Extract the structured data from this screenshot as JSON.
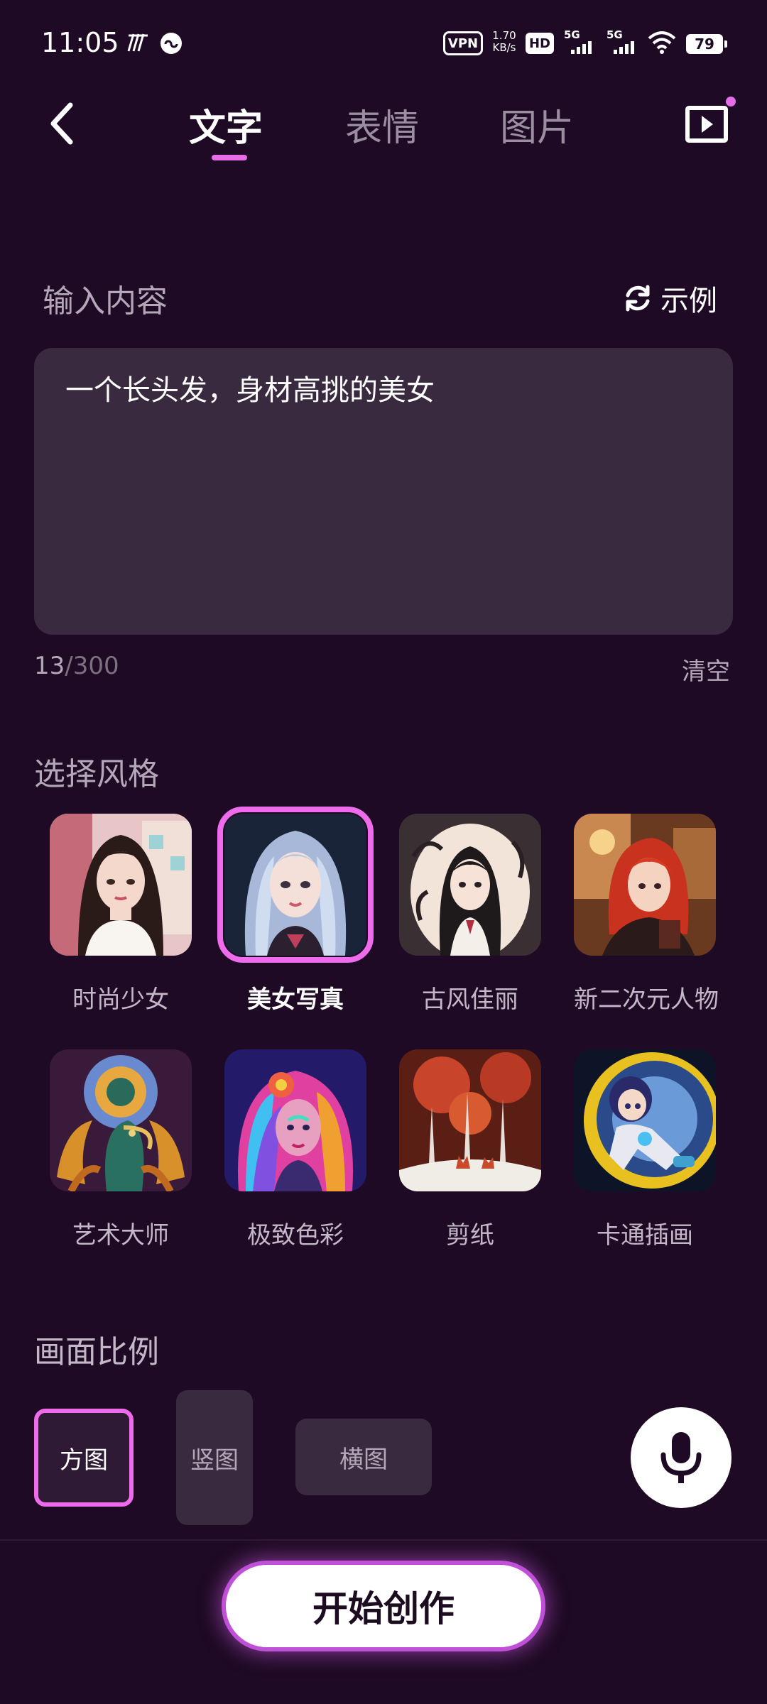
{
  "status_bar": {
    "time": "11:05",
    "vpn": "VPN",
    "speed_value": "1.70",
    "speed_unit": "KB/s",
    "hd": "HD",
    "net1": "5G",
    "net2": "5G",
    "battery": "79"
  },
  "nav": {
    "tabs": [
      "文字",
      "表情",
      "图片"
    ],
    "active_tab": 0
  },
  "input": {
    "label": "输入内容",
    "example_label": "示例",
    "value": "一个长头发，身材高挑的美女",
    "count_current": "13",
    "count_max": "/300",
    "clear_label": "清空"
  },
  "styles": {
    "label": "选择风格",
    "items": [
      {
        "name": "时尚少女",
        "icon": "portrait-fashion-girl"
      },
      {
        "name": "美女写真",
        "icon": "portrait-beauty-photo"
      },
      {
        "name": "古风佳丽",
        "icon": "portrait-ancient-style"
      },
      {
        "name": "新二次元人物",
        "icon": "portrait-anime-character"
      },
      {
        "name": "艺术大师",
        "icon": "portrait-art-master"
      },
      {
        "name": "极致色彩",
        "icon": "portrait-vivid-color"
      },
      {
        "name": "剪纸",
        "icon": "paper-cut-art"
      },
      {
        "name": "卡通插画",
        "icon": "cartoon-illustration"
      }
    ],
    "selected_index": 1
  },
  "ratio": {
    "label": "画面比例",
    "options": [
      "方图",
      "竖图",
      "横图"
    ],
    "selected_index": 0
  },
  "start_button": "开始创作",
  "colors": {
    "background": "#1e0a24",
    "accent": "#ee6bec",
    "card": "#3a2a40"
  }
}
